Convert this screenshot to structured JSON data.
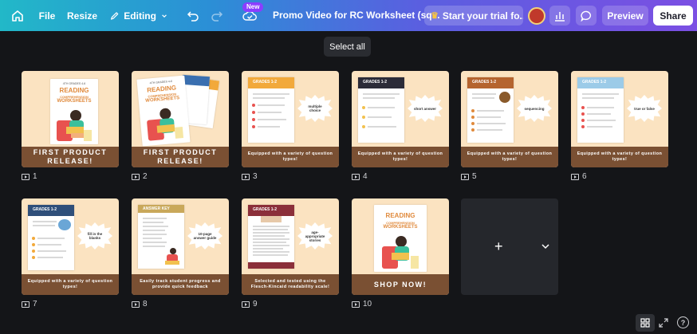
{
  "toolbar": {
    "file_label": "File",
    "resize_label": "Resize",
    "editing_label": "Editing",
    "new_badge": "New",
    "title": "Promo Video for RC Worksheet (sq...",
    "trial_label": "Start your trial fo...",
    "preview_label": "Preview",
    "share_label": "Share"
  },
  "select_all_label": "Select all",
  "pages": [
    {
      "number": "1",
      "caption": "FIRST PRODUCT RELEASE!",
      "book_grade": "4TH GRADES 4-6",
      "book_title_1": "READING",
      "book_title_2": "COMPREHENSION",
      "book_title_3": "WORKSHEETS"
    },
    {
      "number": "2",
      "caption": "FIRST PRODUCT RELEASE!",
      "book_grade": "4TH GRADES 4-6",
      "book_title_1": "READING",
      "book_title_2": "COMPREHENSION",
      "book_title_3": "WORKSHEETS"
    },
    {
      "number": "3",
      "caption": "Equipped with a variety of question types!",
      "sheet_title": "GRADES 1-2",
      "burst": "multiple choice"
    },
    {
      "number": "4",
      "caption": "Equipped with a variety of question types!",
      "sheet_title": "GRADES 1-2",
      "burst": "short answer"
    },
    {
      "number": "5",
      "caption": "Equipped with a variety of question types!",
      "sheet_title": "GRADES 1-2",
      "burst": "sequencing"
    },
    {
      "number": "6",
      "caption": "Equipped with a variety of question types!",
      "sheet_title": "GRADES 1-2",
      "burst": "true or false"
    },
    {
      "number": "7",
      "caption": "Equipped with a variety of question types!",
      "sheet_title": "GRADES 1-2",
      "burst": "fill in the blanks"
    },
    {
      "number": "8",
      "caption": "Easily track student progress and provide quick feedback",
      "sheet_title": "ANSWER KEY",
      "burst": "10-page answer guide"
    },
    {
      "number": "9",
      "caption": "Selected and tested using the Flesch-Kincaid readability scale!",
      "sheet_title": "GRADES 1-2",
      "burst": "age-appropriate stories"
    },
    {
      "number": "10",
      "caption": "SHOP NOW!",
      "book_title_1": "READING",
      "book_title_2": "COMPREHENSION",
      "book_title_3": "WORKSHEETS"
    }
  ],
  "add_page": {
    "plus": "+"
  },
  "help_label": "?",
  "colors": {
    "caption_bg": "#7a5033",
    "card_bg": "#fbe3c1",
    "share_bg": "#ffffff",
    "badge_bg": "#8b3dff"
  },
  "icons": {
    "home": "home-icon",
    "editing": "pencil-icon",
    "undo": "undo-icon",
    "redo": "redo-icon",
    "cloud": "cloud-check-icon",
    "crown": "crown-icon",
    "stats": "bar-chart-icon",
    "comment": "comment-icon",
    "grid": "grid-view-icon",
    "expand": "fullscreen-icon",
    "help": "help-icon"
  }
}
